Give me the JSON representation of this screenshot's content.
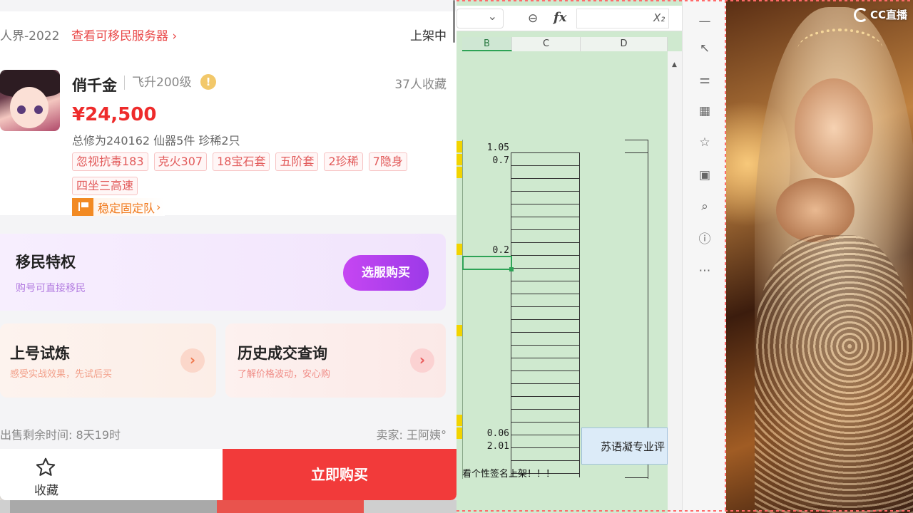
{
  "app": {
    "server_prefix": "人界-2022",
    "server_link": "查看可移民服务器",
    "status": "上架中",
    "seller_name": "俏千金",
    "level": "飞升200级",
    "info_icon": "!",
    "fav_count": "37人收藏",
    "price": "¥24,500",
    "summary": "总修为240162  仙器5件  珍稀2只",
    "tags": [
      "忽视抗毒183",
      "克火307",
      "18宝石套",
      "五阶套",
      "2珍稀",
      "7隐身",
      "四坐三高速"
    ],
    "team_badge": "稳定固定队",
    "migrate": {
      "title": "移民特权",
      "subtitle": "购号可直接移民",
      "button": "选服购买"
    },
    "features": [
      {
        "title": "上号试炼",
        "subtitle": "感受实战效果，先试后买",
        "arrow": "›"
      },
      {
        "title": "历史成交查询",
        "subtitle": "了解价格波动，安心购",
        "arrow": "›"
      }
    ],
    "timer": "出售剩余时间: 8天19时",
    "seller": "卖家: 王阿姨°",
    "fav_label": "收藏",
    "buy_label": "立即购买"
  },
  "sheet": {
    "formula_icon": "fx",
    "columns": [
      "B",
      "C",
      "D"
    ],
    "values": [
      {
        "row": "r1",
        "text": "1.05"
      },
      {
        "row": "r2",
        "text": "0.7"
      },
      {
        "row": "r3",
        "text": "0.2"
      },
      {
        "row": "r4",
        "text": "0.06"
      },
      {
        "row": "r5",
        "text": "2.01"
      }
    ],
    "blue_cell": "苏语凝专业评",
    "note": "看个性签名上架！！！"
  },
  "toolbar": {
    "icons": [
      "minimize-icon",
      "cursor-icon",
      "sliders-icon",
      "table-icon",
      "star-sparkle-icon",
      "image-icon",
      "search-doc-icon",
      "help-icon",
      "more-icon"
    ]
  },
  "stream": {
    "logo_text": "CC直播"
  },
  "colors": {
    "price": "#ee2b2b",
    "buy_button": "#f23a3a",
    "migrate_button": "#c646f2",
    "sheet_bg": "#cfe9cf",
    "selection": "#2ea356"
  }
}
